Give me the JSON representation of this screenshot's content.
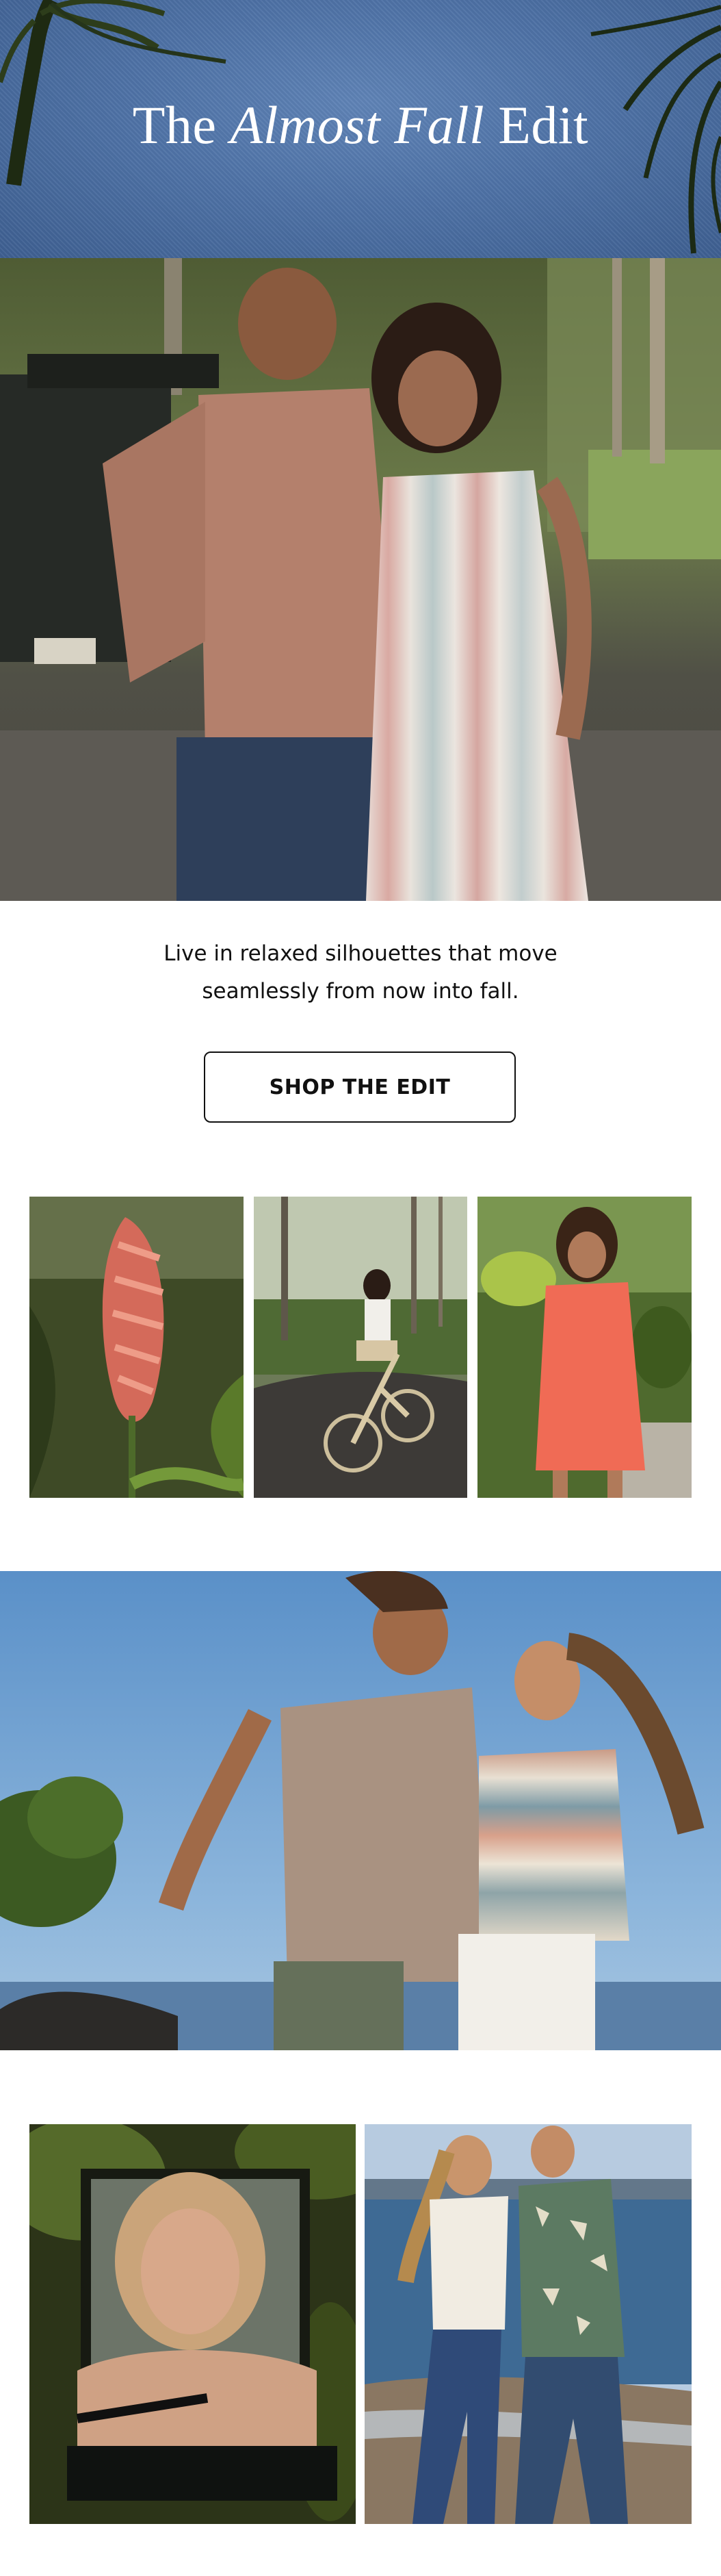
{
  "header": {
    "headline_pre": "The",
    "headline_italic": "Almost Fall",
    "headline_post": "Edit"
  },
  "body_copy": {
    "line1": "Live in relaxed silhouettes that move",
    "line2": "seamlessly from now into fall."
  },
  "cta": {
    "label": "SHOP THE EDIT"
  },
  "colors": {
    "header_blue": "#4e72a6",
    "text": "#111111",
    "button_border": "#111111",
    "background": "#ffffff"
  },
  "images": [
    "hero-couple-photo",
    "ginger-flower-photo",
    "bicycle-rider-photo",
    "coral-dress-photo",
    "beach-couple-photo",
    "woman-portrait-photo",
    "shoreline-couple-photo"
  ]
}
